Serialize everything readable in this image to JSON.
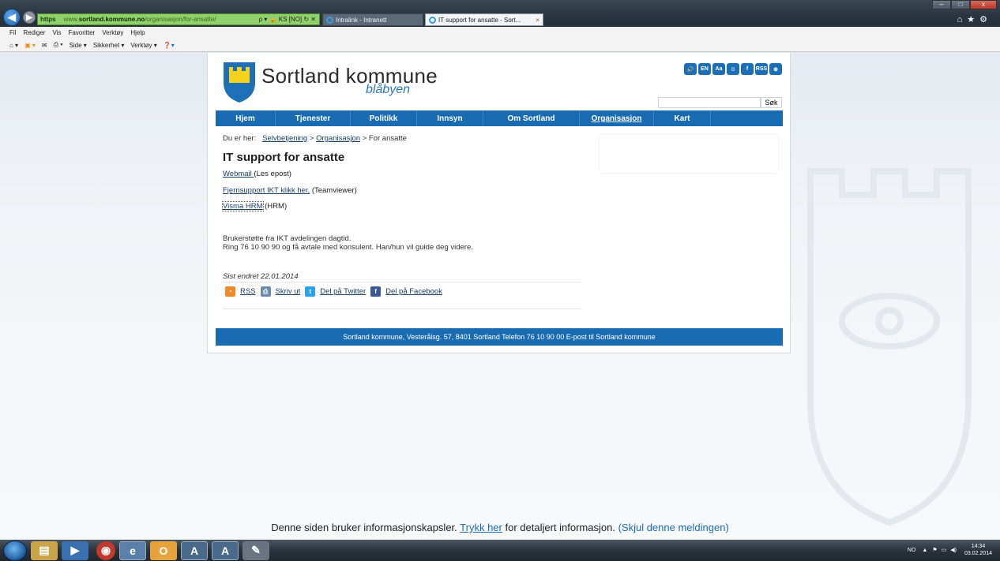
{
  "browser": {
    "address": {
      "protocol": "https",
      "domain_prefix": "www.",
      "domain": "sortland.kommune.no",
      "path": "/organisasjon/for-ansatte/",
      "right_text": "ρ ▾ 🔒 KS [NO] ↻ ✕"
    },
    "tabs": [
      {
        "label": "Intralink - Intranett"
      },
      {
        "label": "IT support for ansatte - Sort...",
        "close": "×"
      }
    ],
    "menu": [
      "Fil",
      "Rediger",
      "Vis",
      "Favoritter",
      "Verktøy",
      "Hjelp"
    ],
    "command_bar": [
      "Side ▾",
      "Sikkerhet ▾",
      "Verktøy ▾"
    ],
    "window_controls": {
      "minimize": "–",
      "maximize": "□",
      "close": "x"
    }
  },
  "site": {
    "name": "Sortland kommune",
    "slogan": "blåbyen",
    "tools": [
      "🔊",
      "EN",
      "Aa",
      "⁝⁝",
      "f",
      "RSS",
      "⊕"
    ],
    "search": {
      "placeholder": "",
      "button": "Søk"
    },
    "nav": [
      {
        "label": "Hjem",
        "active": false
      },
      {
        "label": "Tjenester",
        "active": false
      },
      {
        "label": "Politikk",
        "active": false
      },
      {
        "label": "Innsyn",
        "active": false
      },
      {
        "label": "Om Sortland",
        "active": false
      },
      {
        "label": "Organisasjon",
        "active": true
      },
      {
        "label": "Kart",
        "active": false
      }
    ],
    "breadcrumb": {
      "prefix": "Du er her:",
      "items": [
        "Selvbetjening",
        "Organisasjon",
        "For ansatte"
      ],
      "separator": ">"
    },
    "title": "IT support for ansatte",
    "links": [
      {
        "link": "Webmail ",
        "suffix": " (Les epost)"
      },
      {
        "link": "Fjernsupport IKT klikk her.",
        "suffix": " (Teamviewer)"
      },
      {
        "link": "Visma HRM",
        "suffix": " (HRM)"
      }
    ],
    "body_lines": [
      "Brukerstøtte fra IKT avdelingen dagtid.",
      "Ring 76 10 90 90 og få avtale med konsulent. Han/hun vil guide deg videre."
    ],
    "last_updated": "Sist endret 22.01.2014",
    "share": [
      {
        "label": "RSS",
        "icon": "rss-icon",
        "color": "#f08a24"
      },
      {
        "label": "Skriv ut",
        "icon": "print-icon",
        "color": "#6c8aa8"
      },
      {
        "label": "Del på Twitter",
        "icon": "twitter-icon",
        "color": "#2aa3ef"
      },
      {
        "label": "Del på Facebook",
        "icon": "facebook-icon",
        "color": "#3b5998"
      }
    ],
    "footer": "Sortland kommune, Vesterålsg. 57, 8401 Sortland Telefon 76 10 90 00 E-post til Sortland kommune",
    "brand_color": "#1a6cb2"
  },
  "cookie_notice": {
    "text": "Denne siden bruker informasjonskapsler.",
    "link": "Trykk her",
    "after": "for detaljert informasjon.",
    "hide": "(Skjul denne meldingen)"
  },
  "taskbar": {
    "apps": [
      "explorer",
      "media-player",
      "chrome",
      "internet-explorer",
      "outlook",
      "a-app-1",
      "a-app-2",
      "tools"
    ],
    "tray": {
      "lang": "NO",
      "time": "14:34",
      "date": "03.02.2014"
    }
  }
}
